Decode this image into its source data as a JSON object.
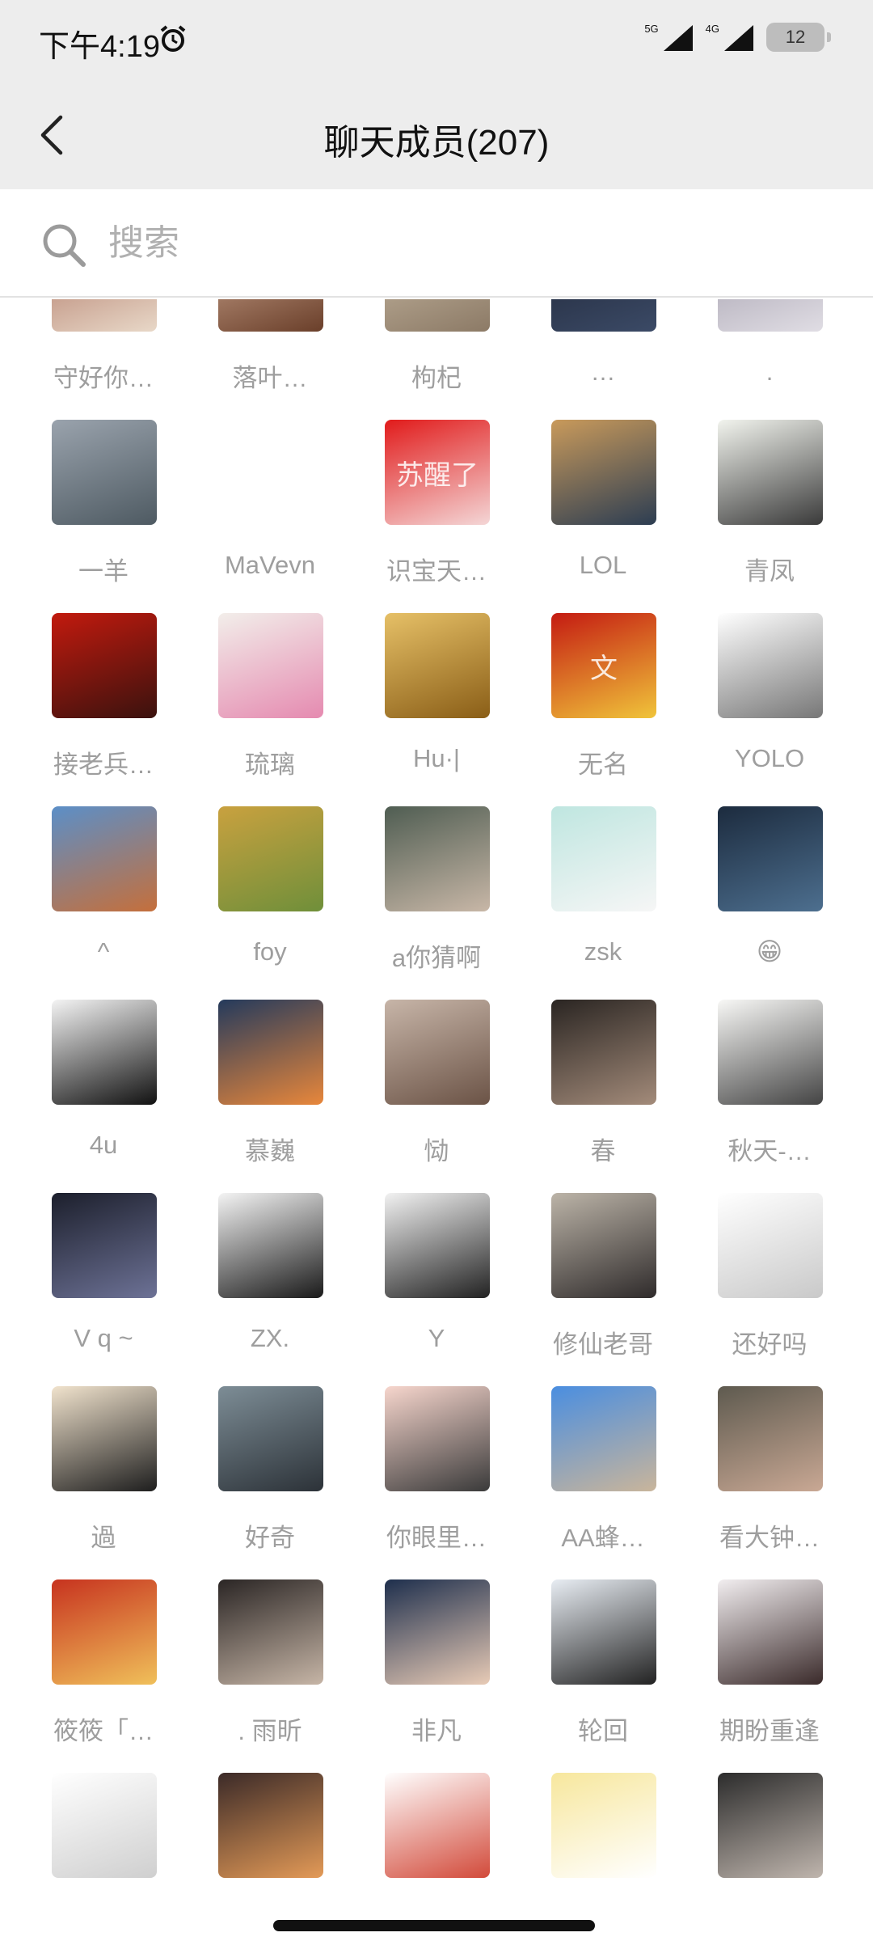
{
  "status_bar": {
    "time": "下午4:19",
    "network_5g": "5G",
    "network_4g": "4G",
    "battery": "12"
  },
  "header": {
    "title": "聊天成员(207)"
  },
  "search": {
    "placeholder": "搜索"
  },
  "members": [
    {
      "name": "守好你…",
      "colors": [
        "#a86a58",
        "#e8d8c8"
      ]
    },
    {
      "name": "落叶…",
      "colors": [
        "#d7b19a",
        "#6a3f2a"
      ]
    },
    {
      "name": "枸杞",
      "colors": [
        "#cdbfa9",
        "#8c7a66"
      ]
    },
    {
      "name": "…",
      "colors": [
        "#1d2333",
        "#3b4a66"
      ]
    },
    {
      "name": ".",
      "colors": [
        "#9c97a6",
        "#e0dde4"
      ]
    },
    {
      "name": "一羊",
      "colors": [
        "#9aa3ad",
        "#4e5a62"
      ]
    },
    {
      "name": "MaVevn",
      "colors": [
        "#ffffff",
        "#ffffff"
      ],
      "no_avatar": true
    },
    {
      "name": "识宝天…",
      "colors": [
        "#e11b1b",
        "#f4d6d6"
      ],
      "glyph": "苏醒了"
    },
    {
      "name": "LOL",
      "colors": [
        "#c99a5b",
        "#2c3d52"
      ]
    },
    {
      "name": "青凤",
      "colors": [
        "#f2f4ee",
        "#3a3a3a"
      ]
    },
    {
      "name": "接老兵…",
      "colors": [
        "#c21a0e",
        "#3a120e"
      ]
    },
    {
      "name": "琉璃",
      "colors": [
        "#f2eeea",
        "#e58ab0"
      ]
    },
    {
      "name": "Hu·|",
      "colors": [
        "#e6c067",
        "#8a5e17"
      ]
    },
    {
      "name": "无名",
      "colors": [
        "#c41b12",
        "#f0c43a"
      ],
      "glyph": "文"
    },
    {
      "name": "YOLO",
      "colors": [
        "#ffffff",
        "#777777"
      ]
    },
    {
      "name": "^",
      "colors": [
        "#5b8fc8",
        "#c56f3b"
      ]
    },
    {
      "name": "foy",
      "colors": [
        "#c9a13f",
        "#6f8f3a"
      ]
    },
    {
      "name": "a你猜啊",
      "colors": [
        "#4f5d52",
        "#c8b7a7"
      ]
    },
    {
      "name": "zsk",
      "colors": [
        "#bfe6e0",
        "#f6f6f6"
      ]
    },
    {
      "name": "😁",
      "colors": [
        "#1c2b3e",
        "#4d6f8f"
      ]
    },
    {
      "name": "4u",
      "colors": [
        "#f4f4f4",
        "#111111"
      ]
    },
    {
      "name": "慕巍",
      "colors": [
        "#243a5c",
        "#e8873b"
      ]
    },
    {
      "name": "恸",
      "colors": [
        "#c7b5a8",
        "#6b5346"
      ]
    },
    {
      "name": "春",
      "colors": [
        "#2a2522",
        "#a38b7a"
      ]
    },
    {
      "name": "秋天-…",
      "colors": [
        "#f8f8f6",
        "#444444"
      ]
    },
    {
      "name": "V q ~",
      "colors": [
        "#1c1f2c",
        "#6d7296"
      ]
    },
    {
      "name": "ZX.",
      "colors": [
        "#f4f4f4",
        "#1a1a1a"
      ]
    },
    {
      "name": "Y",
      "colors": [
        "#f2f2f2",
        "#222222"
      ]
    },
    {
      "name": "修仙老哥",
      "colors": [
        "#bcb4a8",
        "#2f2b2b"
      ]
    },
    {
      "name": "还好吗",
      "colors": [
        "#ffffff",
        "#c9c9c9"
      ]
    },
    {
      "name": "過",
      "colors": [
        "#f1e3cd",
        "#1e1e1e"
      ]
    },
    {
      "name": "好奇",
      "colors": [
        "#7d8d96",
        "#2c3238"
      ]
    },
    {
      "name": "你眼里…",
      "colors": [
        "#f7d6cd",
        "#3a3a3a"
      ]
    },
    {
      "name": "AA蜂…",
      "colors": [
        "#4a8ee0",
        "#c9b59b"
      ]
    },
    {
      "name": "看大钟…",
      "colors": [
        "#5e5a4f",
        "#c9a894"
      ]
    },
    {
      "name": "筱筱「…",
      "colors": [
        "#c7331f",
        "#f0c05a"
      ]
    },
    {
      "name": ".    雨昕",
      "colors": [
        "#2b2625",
        "#c6b5a6"
      ]
    },
    {
      "name": "非凡",
      "colors": [
        "#1e2f4d",
        "#e8cbb6"
      ]
    },
    {
      "name": "轮回",
      "colors": [
        "#e8edf3",
        "#222222"
      ]
    },
    {
      "name": "期盼重逢",
      "colors": [
        "#f2eef0",
        "#3a2a2a"
      ]
    },
    {
      "name": "",
      "colors": [
        "#ffffff",
        "#cfcfcf"
      ]
    },
    {
      "name": "",
      "colors": [
        "#3b2a28",
        "#e39a57"
      ]
    },
    {
      "name": "",
      "colors": [
        "#ffffff",
        "#d24a3a"
      ]
    },
    {
      "name": "",
      "colors": [
        "#f7e79d",
        "#ffffff"
      ]
    },
    {
      "name": "",
      "colors": [
        "#2c2c2c",
        "#bfb5ad"
      ]
    }
  ]
}
